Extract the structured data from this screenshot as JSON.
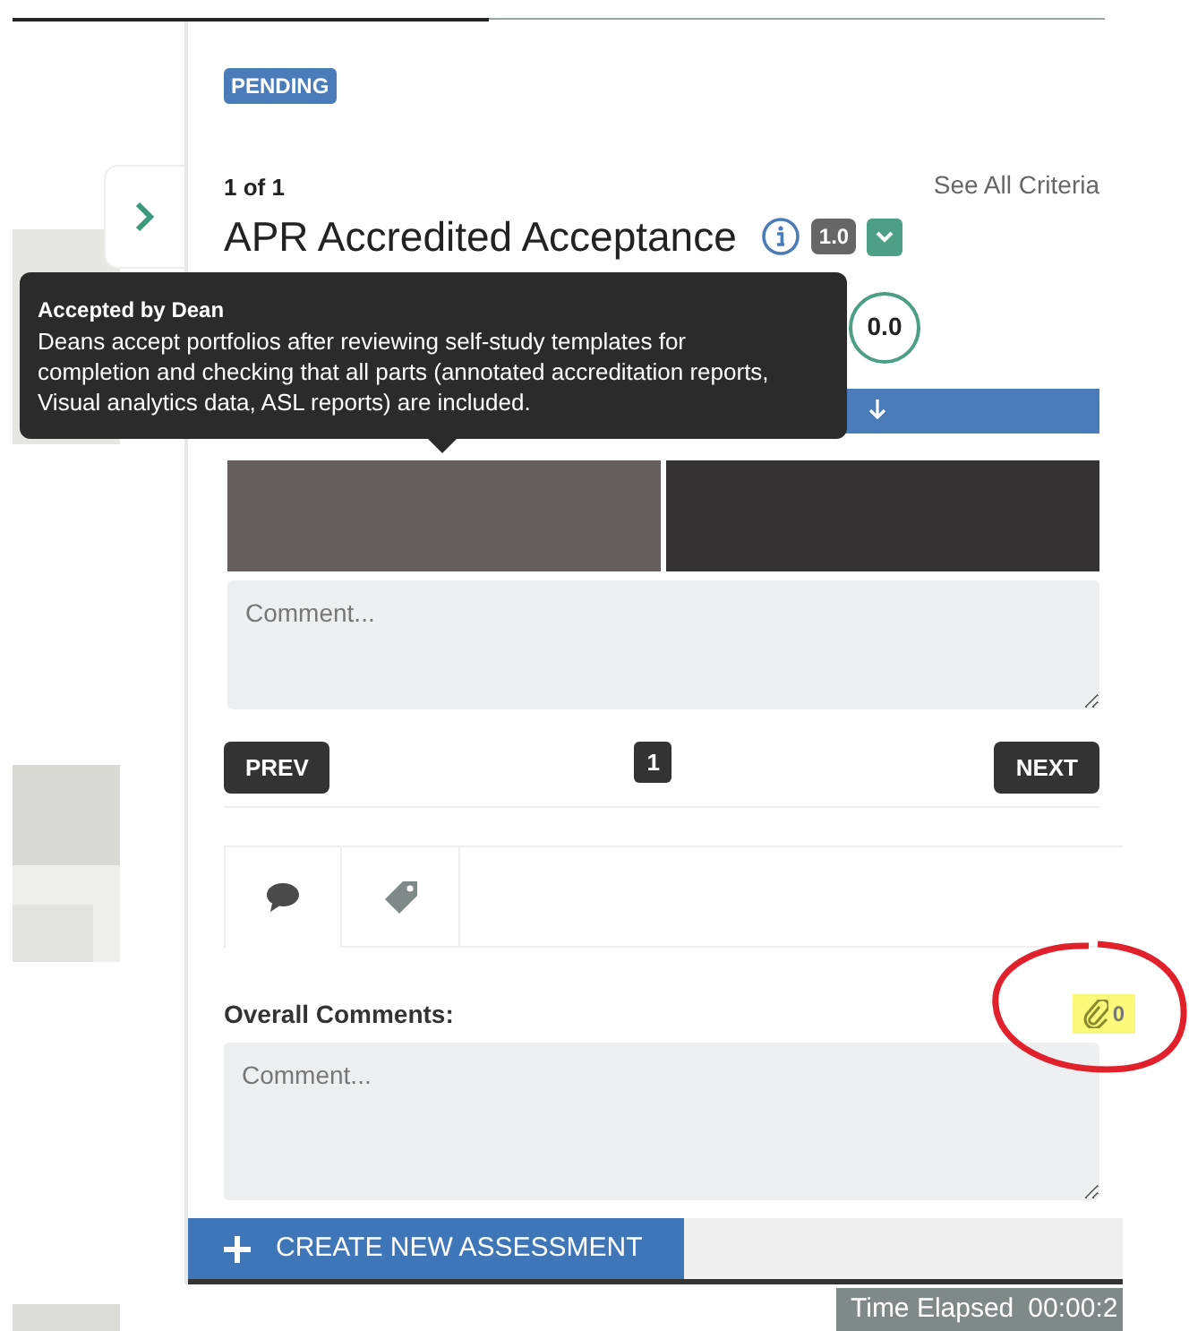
{
  "status_badge": "PENDING",
  "criterion": {
    "counter": "1 of 1",
    "see_all": "See All Criteria",
    "title": "APR Accredited Acceptance",
    "version": "1.0",
    "score": "0.0"
  },
  "tooltip": {
    "title": "Accepted by Dean",
    "text": "Deans accept portfolios after reviewing self-study templates for completion and checking that all parts (annotated accreditation reports, Visual analytics data, ASL reports) are included."
  },
  "levels": [
    {
      "selected": true
    },
    {
      "selected": false
    }
  ],
  "criterion_comment": {
    "placeholder": "Comment..."
  },
  "pagination": {
    "prev": "PREV",
    "page": "1",
    "next": "NEXT"
  },
  "tabs": [
    {
      "kind": "comment",
      "selected": true
    },
    {
      "kind": "tag",
      "selected": false
    }
  ],
  "overall_comments": {
    "label": "Overall Comments:",
    "attachments": "0",
    "placeholder": "Comment..."
  },
  "create_button": "CREATE NEW ASSESSMENT",
  "timer": {
    "label": "Time Elapsed",
    "value": "00:00:2"
  }
}
